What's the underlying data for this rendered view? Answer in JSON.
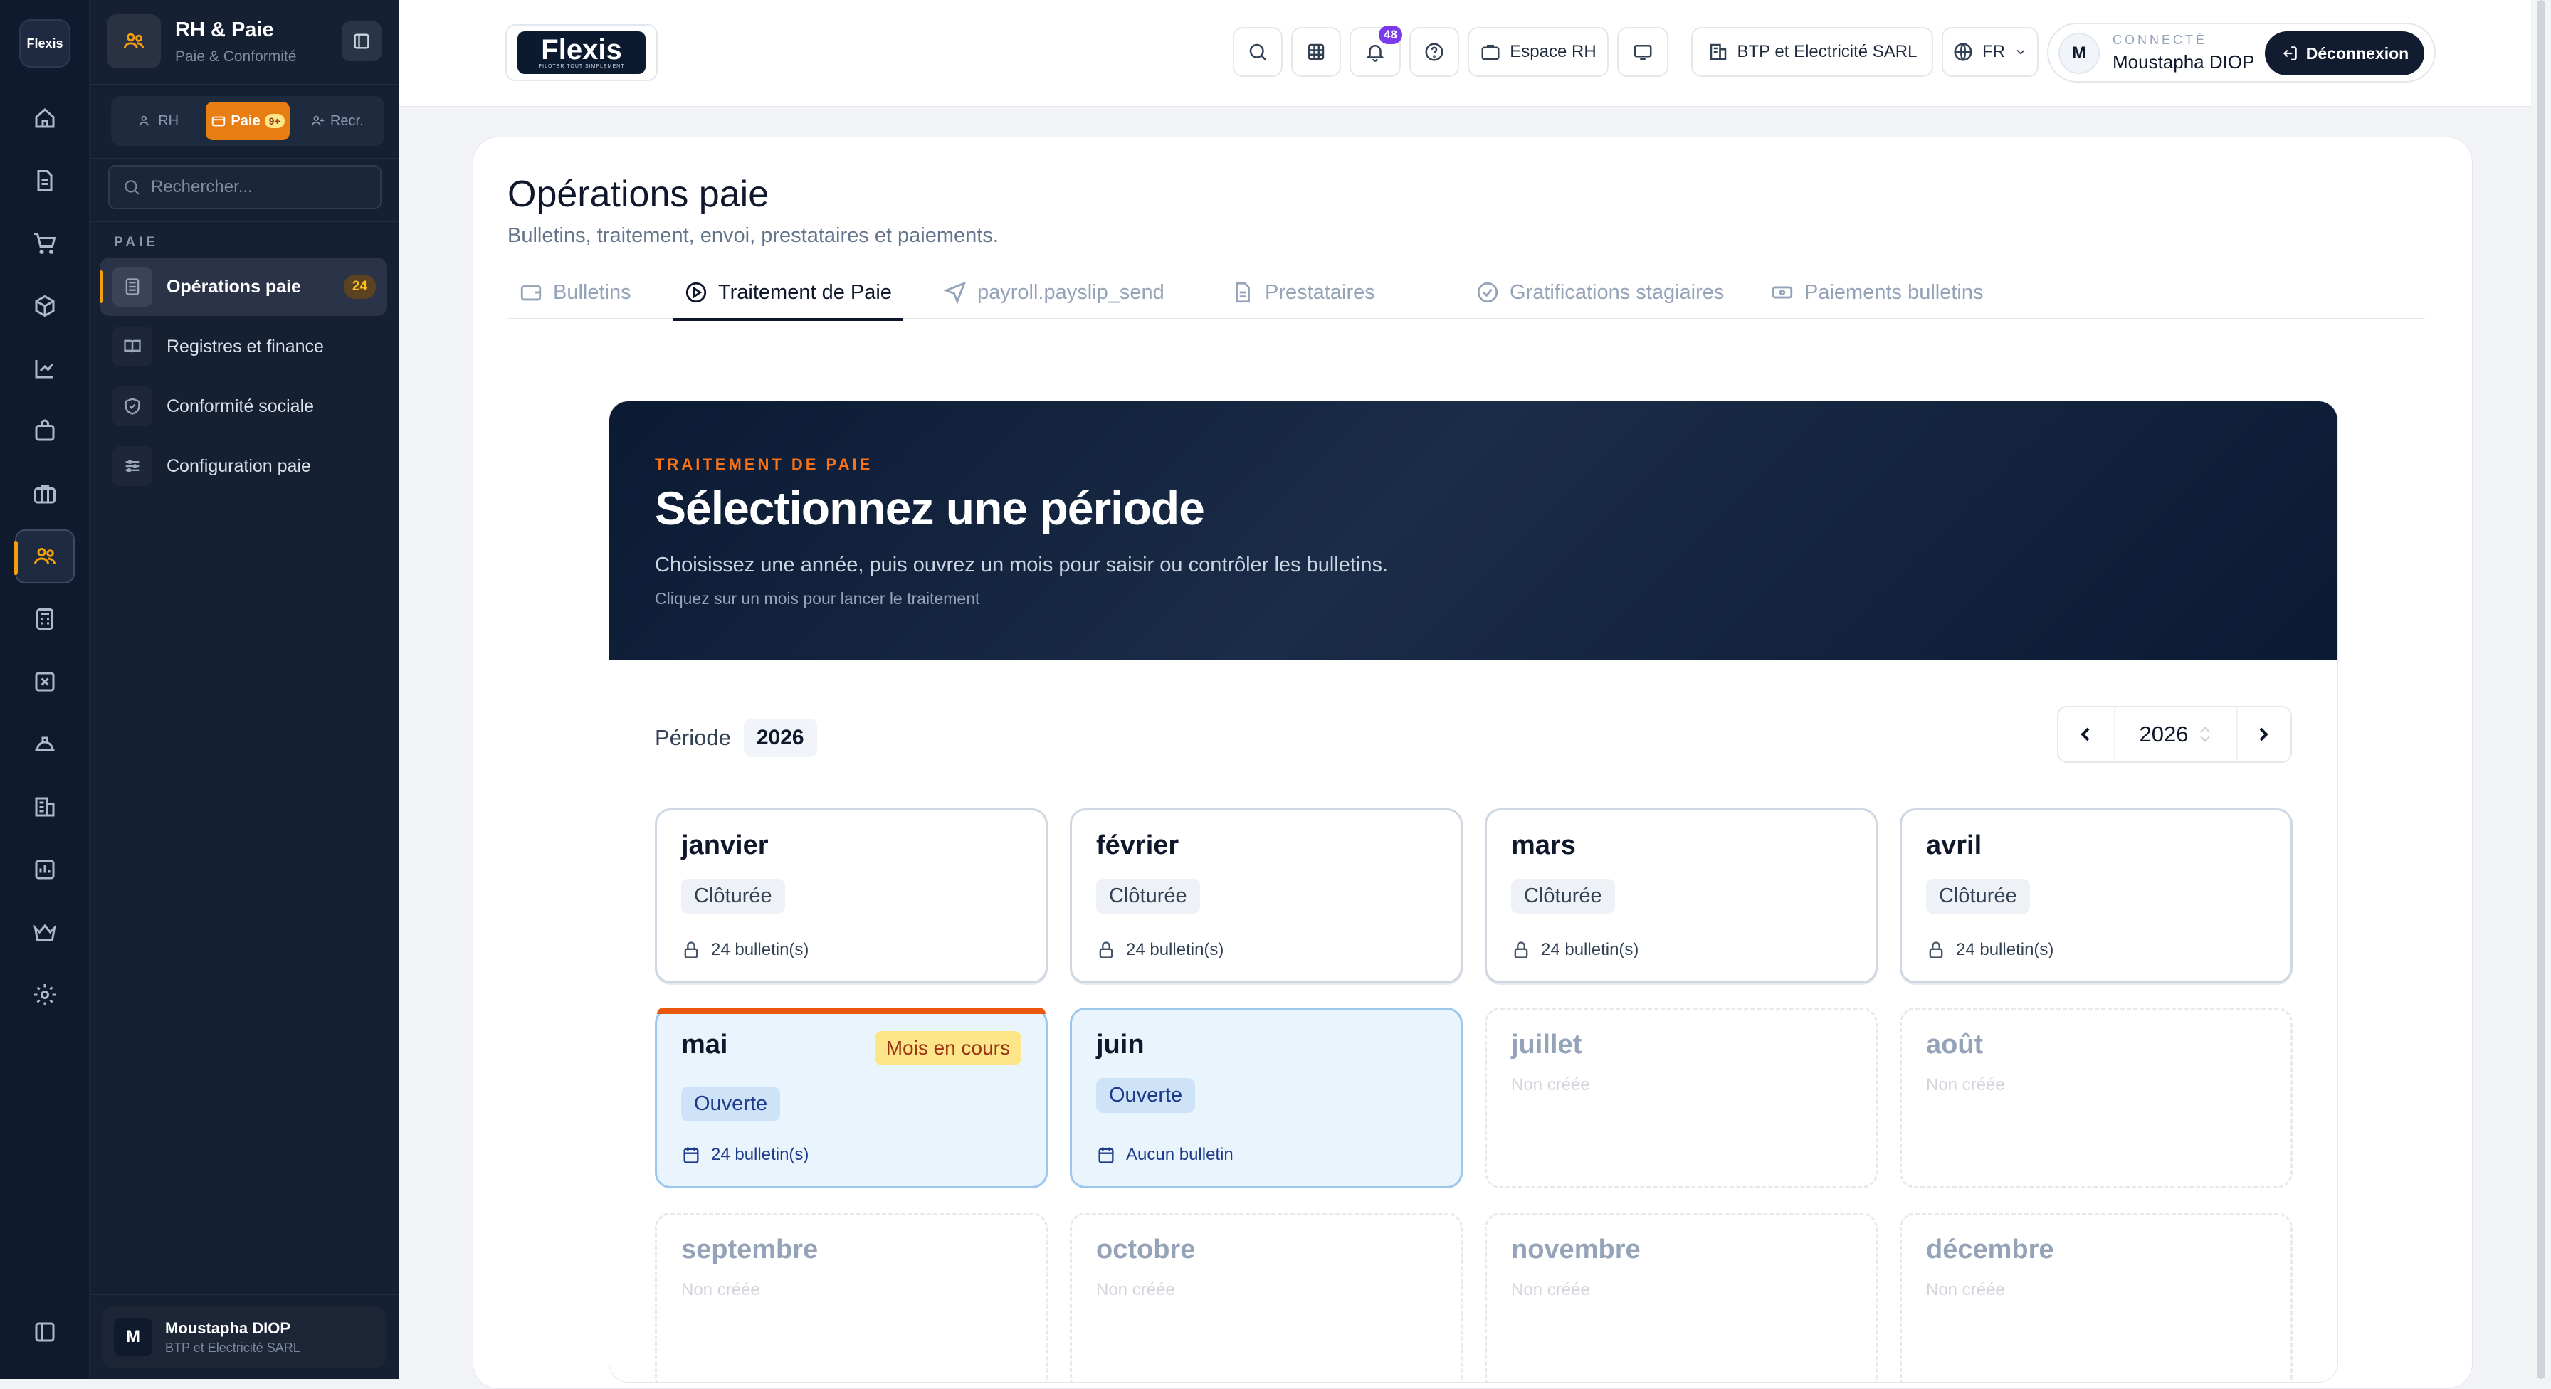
{
  "rail": {
    "logo": "Flexis",
    "icons": [
      "home-icon",
      "document-icon",
      "cart-icon",
      "box-icon",
      "chart-icon",
      "bag-icon",
      "briefcase-icon",
      "users-icon",
      "calculator-icon",
      "x-square-icon",
      "hardhat-icon",
      "building-icon",
      "report-icon",
      "crown-icon",
      "gear-icon"
    ],
    "active_index": 7,
    "bottom_icon": "sidebar-toggle-icon"
  },
  "sidebar": {
    "title": "RH & Paie",
    "subtitle": "Paie & Conformité",
    "segments": [
      {
        "label": "RH",
        "icon": "users-icon"
      },
      {
        "label": "Paie",
        "icon": "wallet-icon",
        "badge": "9+",
        "active": true
      },
      {
        "label": "Recr.",
        "icon": "user-plus-icon"
      }
    ],
    "search_placeholder": "Rechercher...",
    "section_label": "PAIE",
    "items": [
      {
        "label": "Opérations paie",
        "icon": "calculator-icon",
        "count": "24",
        "active": true
      },
      {
        "label": "Registres et finance",
        "icon": "book-icon"
      },
      {
        "label": "Conformité sociale",
        "icon": "shield-icon"
      },
      {
        "label": "Configuration paie",
        "icon": "sliders-icon"
      }
    ],
    "user": {
      "initial": "M",
      "name": "Moustapha DIOP",
      "company": "BTP et Electricité SARL"
    }
  },
  "topbar": {
    "brand": "Flexis",
    "brand_tagline": "PILOTER TOUT SIMPLEMENT",
    "notifications_count": "48",
    "espace_label": "Espace RH",
    "company_label": "BTP et Electricité SARL",
    "lang": "FR",
    "connected_label": "CONNECTÉ",
    "user_initial": "M",
    "user_name": "Moustapha DIOP",
    "logout_label": "Déconnexion"
  },
  "page": {
    "title": "Opérations paie",
    "subtitle": "Bulletins, traitement, envoi, prestataires et paiements.",
    "tabs": [
      {
        "label": "Bulletins",
        "icon": "wallet-icon"
      },
      {
        "label": "Traitement de Paie",
        "icon": "play-circle-icon",
        "active": true
      },
      {
        "label": "payroll.payslip_send",
        "icon": "send-icon"
      },
      {
        "label": "Prestataires",
        "icon": "file-icon"
      },
      {
        "label": "Gratifications stagiaires",
        "icon": "check-circle-icon"
      },
      {
        "label": "Paiements bulletins",
        "icon": "banknote-icon"
      }
    ]
  },
  "banner": {
    "kicker": "TRAITEMENT DE PAIE",
    "title": "Sélectionnez une période",
    "subtitle": "Choisissez une année, puis ouvrez un mois pour saisir ou contrôler les bulletins.",
    "hint": "Cliquez sur un mois pour lancer le traitement"
  },
  "period": {
    "label": "Période",
    "year": "2026",
    "selector_year": "2026"
  },
  "months": [
    {
      "name": "janvier",
      "status": "Clôturée",
      "info": "24 bulletin(s)",
      "state": "closed"
    },
    {
      "name": "février",
      "status": "Clôturée",
      "info": "24 bulletin(s)",
      "state": "closed"
    },
    {
      "name": "mars",
      "status": "Clôturée",
      "info": "24 bulletin(s)",
      "state": "closed"
    },
    {
      "name": "avril",
      "status": "Clôturée",
      "info": "24 bulletin(s)",
      "state": "closed"
    },
    {
      "name": "mai",
      "status": "Ouverte",
      "info": "24 bulletin(s)",
      "state": "open",
      "current_label": "Mois en cours"
    },
    {
      "name": "juin",
      "status": "Ouverte",
      "info": "Aucun bulletin",
      "state": "open"
    },
    {
      "name": "juillet",
      "status": "Non créée",
      "state": "new"
    },
    {
      "name": "août",
      "status": "Non créée",
      "state": "new"
    },
    {
      "name": "septembre",
      "status": "Non créée",
      "state": "new"
    },
    {
      "name": "octobre",
      "status": "Non créée",
      "state": "new"
    },
    {
      "name": "novembre",
      "status": "Non créée",
      "state": "new"
    },
    {
      "name": "décembre",
      "status": "Non créée",
      "state": "new"
    }
  ],
  "colors": {
    "accent": "#ea580c",
    "navy": "#0f1a2e",
    "open_blue": "#eaf4fd"
  }
}
